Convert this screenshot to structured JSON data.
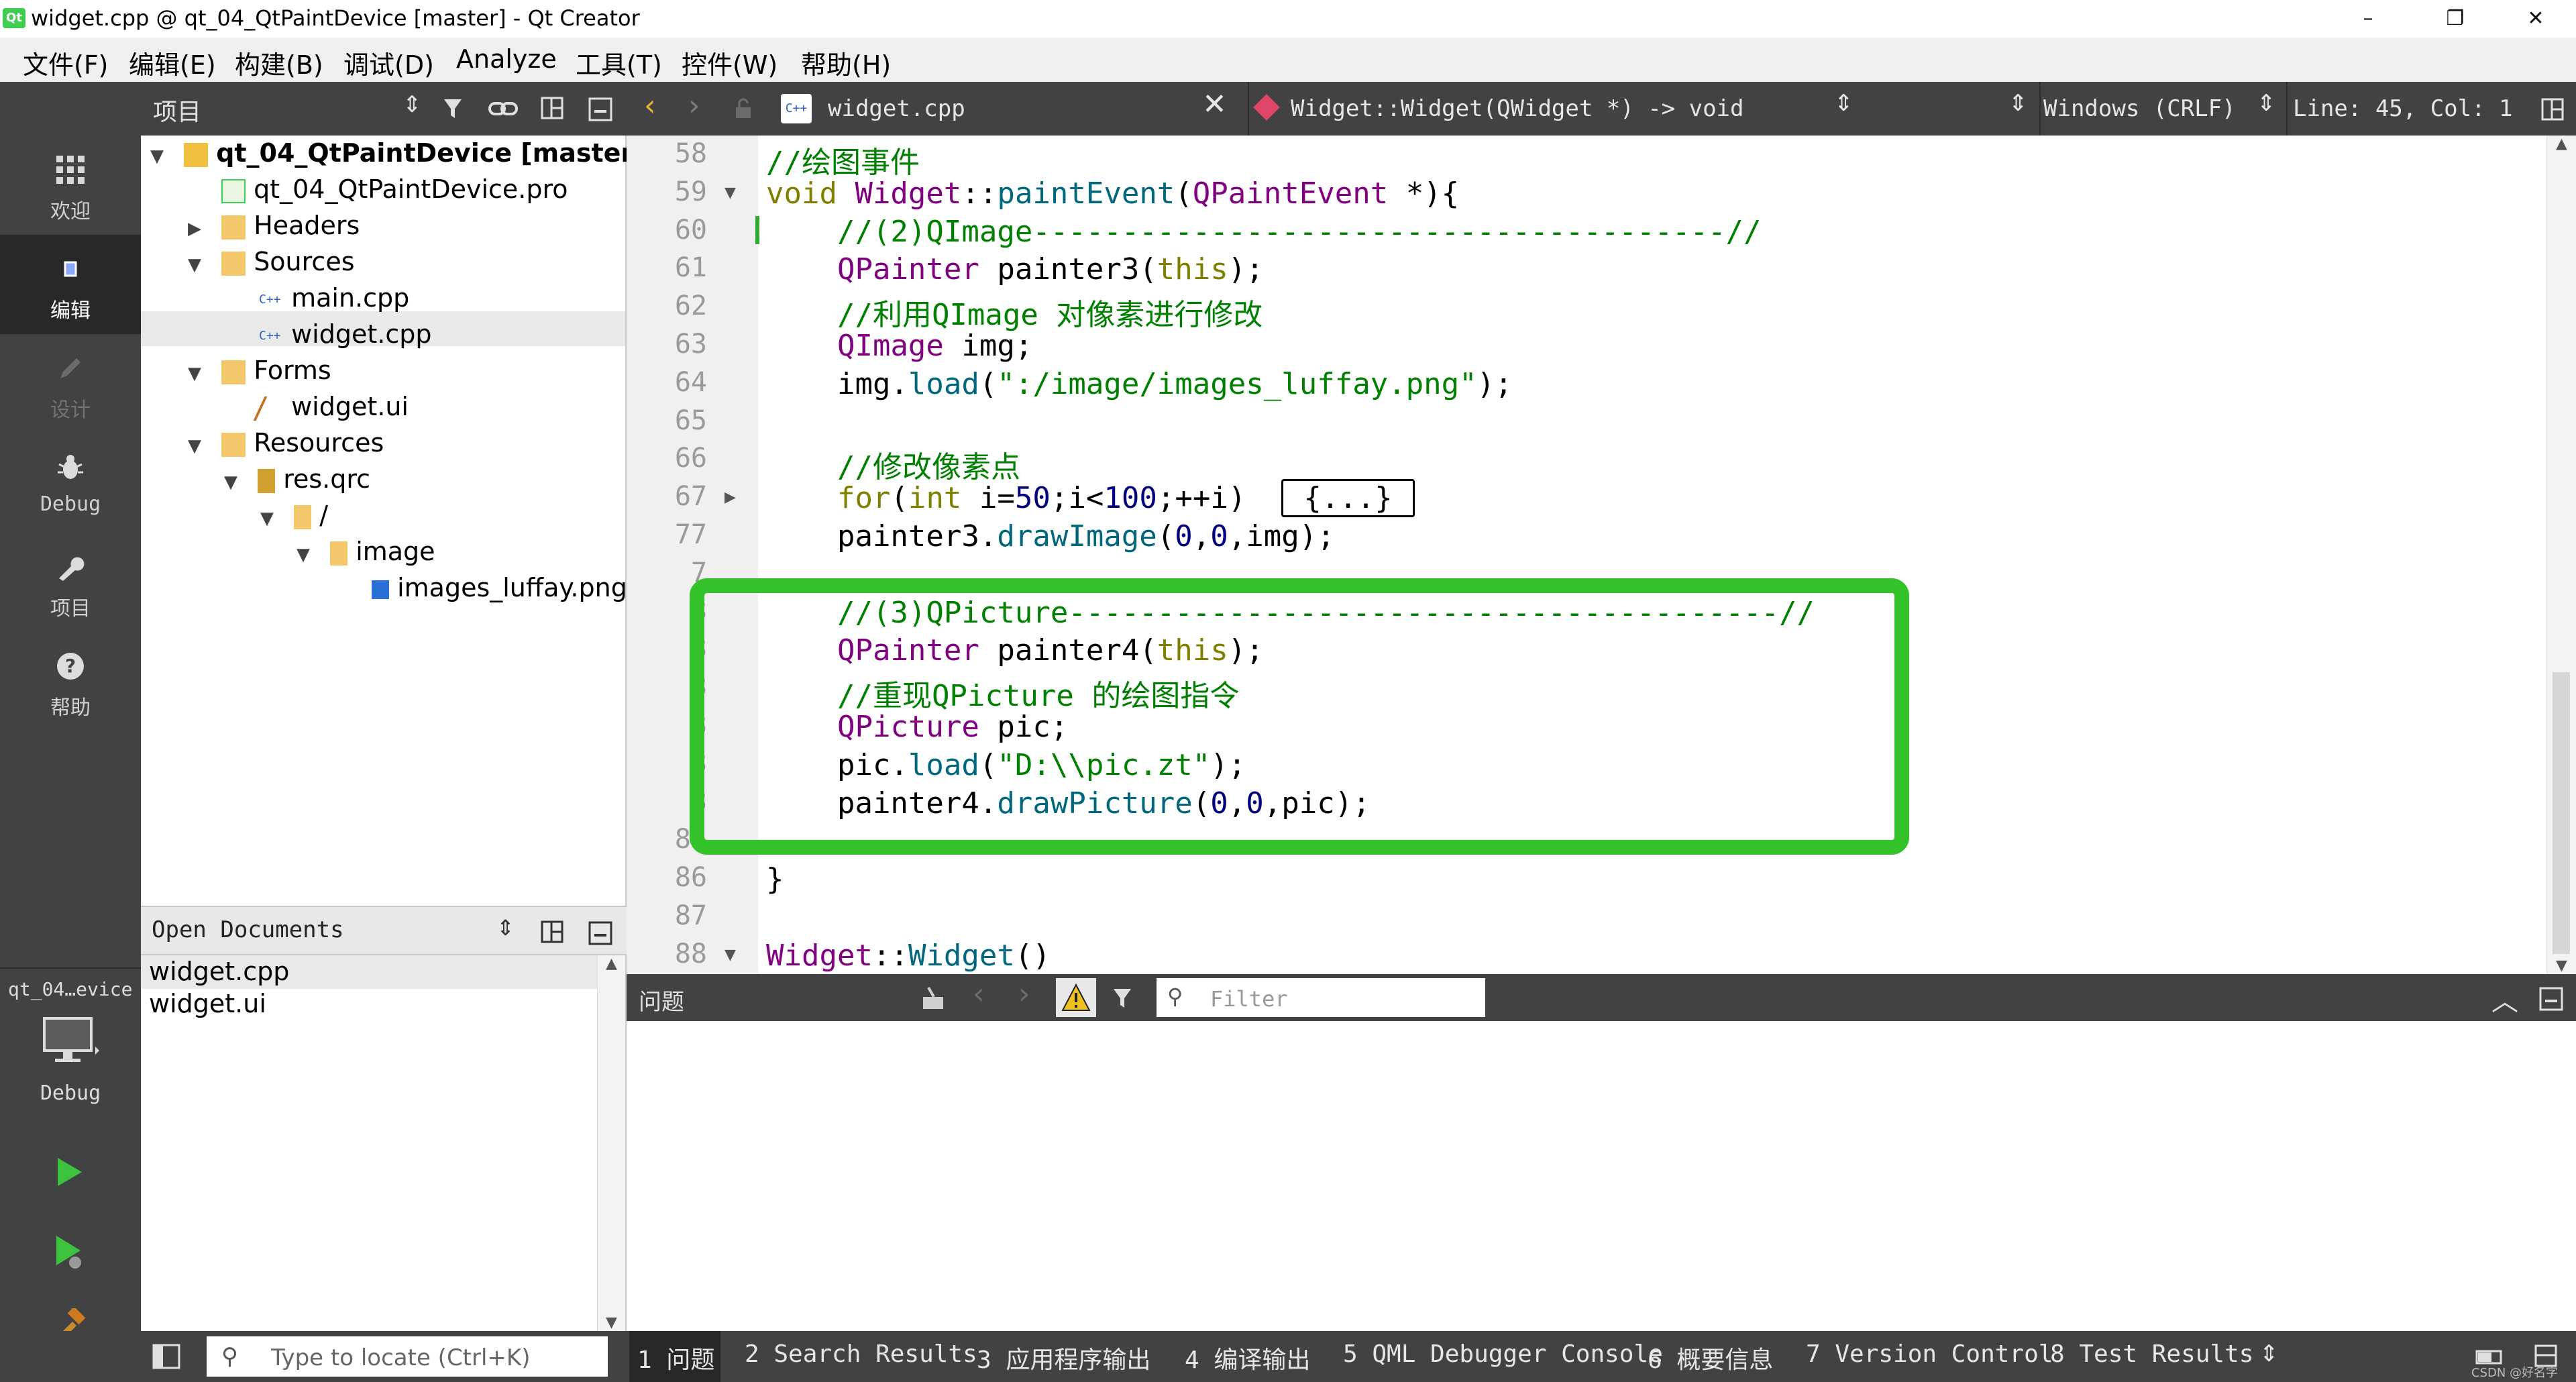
{
  "window": {
    "title": "widget.cpp @ qt_04_QtPaintDevice [master] - Qt Creator",
    "app_icon": "Qt",
    "controls": [
      "–",
      "❐",
      "✕"
    ]
  },
  "menu": [
    "文件(F)",
    "编辑(E)",
    "构建(B)",
    "调试(D)",
    "Analyze",
    "工具(T)",
    "控件(W)",
    "帮助(H)"
  ],
  "modes": [
    {
      "label": "欢迎",
      "icon": "grid-icon"
    },
    {
      "label": "编辑",
      "icon": "edit-doc-icon"
    },
    {
      "label": "设计",
      "icon": "pencil-icon"
    },
    {
      "label": "Debug",
      "icon": "bug-icon"
    },
    {
      "label": "项目",
      "icon": "wrench-icon"
    },
    {
      "label": "帮助",
      "icon": "help-icon"
    }
  ],
  "kit": {
    "name": "qt_04…evice",
    "config": "Debug"
  },
  "project_pane": {
    "title": "项目",
    "tree": [
      {
        "label": "qt_04_QtPaintDevice [master]",
        "level": 0,
        "arrow": "▼",
        "icon": "qt-project"
      },
      {
        "label": "qt_04_QtPaintDevice.pro",
        "level": 1,
        "arrow": "",
        "icon": "pro-file"
      },
      {
        "label": "Headers",
        "level": 1,
        "arrow": "▶",
        "icon": "folder-h"
      },
      {
        "label": "Sources",
        "level": 1,
        "arrow": "▼",
        "icon": "folder-cpp"
      },
      {
        "label": "main.cpp",
        "level": 2,
        "arrow": "",
        "icon": "cpp-file"
      },
      {
        "label": "widget.cpp",
        "level": 2,
        "arrow": "",
        "icon": "cpp-file"
      },
      {
        "label": "Forms",
        "level": 1,
        "arrow": "▼",
        "icon": "folder-forms"
      },
      {
        "label": "widget.ui",
        "level": 2,
        "arrow": "",
        "icon": "ui-file"
      },
      {
        "label": "Resources",
        "level": 1,
        "arrow": "▼",
        "icon": "folder-res"
      },
      {
        "label": "res.qrc",
        "level": 2,
        "arrow": "▼",
        "icon": "qrc-file"
      },
      {
        "label": "/",
        "level": 3,
        "arrow": "▼",
        "icon": "folder"
      },
      {
        "label": "image",
        "level": 4,
        "arrow": "▼",
        "icon": "folder"
      },
      {
        "label": "images_luffay.png",
        "level": 5,
        "arrow": "",
        "icon": "png-file"
      }
    ]
  },
  "open_documents": {
    "title": "Open Documents",
    "items": [
      "widget.cpp",
      "widget.ui"
    ]
  },
  "editor_toolbar": {
    "file": "widget.cpp",
    "symbol": "Widget::Widget(QWidget *) -> void",
    "line_ending": "Windows (CRLF)",
    "position": "Line: 45, Col: 1"
  },
  "code": [
    {
      "ln": "58",
      "fold": "",
      "parts": [
        {
          "t": "//绘图事件",
          "c": "cm"
        }
      ]
    },
    {
      "ln": "59",
      "fold": "▼",
      "parts": [
        {
          "t": "void ",
          "c": "kw"
        },
        {
          "t": "Widget",
          "c": "ty"
        },
        {
          "t": "::",
          "c": ""
        },
        {
          "t": "paintEvent",
          "c": "fn"
        },
        {
          "t": "(",
          "c": ""
        },
        {
          "t": "QPaintEvent",
          "c": "ty"
        },
        {
          "t": " *){",
          "c": ""
        }
      ]
    },
    {
      "ln": "60",
      "fold": "",
      "parts": [
        {
          "t": "    //(2)QImage---------------------------------------//",
          "c": "cm"
        }
      ]
    },
    {
      "ln": "61",
      "fold": "",
      "parts": [
        {
          "t": "    ",
          "c": ""
        },
        {
          "t": "QPainter",
          "c": "ty"
        },
        {
          "t": " painter3(",
          "c": ""
        },
        {
          "t": "this",
          "c": "kw"
        },
        {
          "t": ");",
          "c": ""
        }
      ]
    },
    {
      "ln": "62",
      "fold": "",
      "parts": [
        {
          "t": "    //利用QImage 对像素进行修改",
          "c": "cm"
        }
      ]
    },
    {
      "ln": "63",
      "fold": "",
      "parts": [
        {
          "t": "    ",
          "c": ""
        },
        {
          "t": "QImage",
          "c": "ty"
        },
        {
          "t": " img;",
          "c": ""
        }
      ]
    },
    {
      "ln": "64",
      "fold": "",
      "parts": [
        {
          "t": "    img.",
          "c": ""
        },
        {
          "t": "load",
          "c": "fn"
        },
        {
          "t": "(",
          "c": ""
        },
        {
          "t": "\":/image/images_luffay.png\"",
          "c": "st"
        },
        {
          "t": ");",
          "c": ""
        }
      ]
    },
    {
      "ln": "65",
      "fold": "",
      "parts": []
    },
    {
      "ln": "66",
      "fold": "",
      "parts": [
        {
          "t": "    //修改像素点",
          "c": "cm"
        }
      ]
    },
    {
      "ln": "67",
      "fold": "▶",
      "parts": [
        {
          "t": "    ",
          "c": ""
        },
        {
          "t": "for",
          "c": "kw"
        },
        {
          "t": "(",
          "c": ""
        },
        {
          "t": "int",
          "c": "kw"
        },
        {
          "t": " i=",
          "c": ""
        },
        {
          "t": "50",
          "c": "nm"
        },
        {
          "t": ";i<",
          "c": ""
        },
        {
          "t": "100",
          "c": "nm"
        },
        {
          "t": ";++i)  ",
          "c": ""
        },
        {
          "t": "{...}",
          "c": "box"
        }
      ]
    },
    {
      "ln": "77",
      "fold": "",
      "parts": [
        {
          "t": "    painter3.",
          "c": ""
        },
        {
          "t": "drawImage",
          "c": "fn"
        },
        {
          "t": "(",
          "c": ""
        },
        {
          "t": "0",
          "c": "nm"
        },
        {
          "t": ",",
          "c": ""
        },
        {
          "t": "0",
          "c": "nm"
        },
        {
          "t": ",img);",
          "c": ""
        }
      ]
    },
    {
      "ln": "7",
      "fold": "",
      "parts": []
    },
    {
      "ln": "8",
      "fold": "",
      "parts": [
        {
          "t": "    //(3)QPicture----------------------------------------//",
          "c": "cm"
        }
      ]
    },
    {
      "ln": "8",
      "fold": "",
      "parts": [
        {
          "t": "    ",
          "c": ""
        },
        {
          "t": "QPainter",
          "c": "ty"
        },
        {
          "t": " painter4(",
          "c": ""
        },
        {
          "t": "this",
          "c": "kw"
        },
        {
          "t": ");",
          "c": ""
        }
      ]
    },
    {
      "ln": "8",
      "fold": "",
      "parts": [
        {
          "t": "    //重现QPicture 的绘图指令",
          "c": "cm"
        }
      ]
    },
    {
      "ln": "8",
      "fold": "",
      "parts": [
        {
          "t": "    ",
          "c": ""
        },
        {
          "t": "QPicture",
          "c": "ty"
        },
        {
          "t": " pic;",
          "c": ""
        }
      ]
    },
    {
      "ln": "8",
      "fold": "",
      "parts": [
        {
          "t": "    pic.",
          "c": ""
        },
        {
          "t": "load",
          "c": "fn"
        },
        {
          "t": "(",
          "c": ""
        },
        {
          "t": "\"D:\\\\pic.zt\"",
          "c": "st"
        },
        {
          "t": ");",
          "c": ""
        }
      ]
    },
    {
      "ln": "8",
      "fold": "",
      "parts": [
        {
          "t": "    painter4.",
          "c": ""
        },
        {
          "t": "drawPicture",
          "c": "fn"
        },
        {
          "t": "(",
          "c": ""
        },
        {
          "t": "0",
          "c": "nm"
        },
        {
          "t": ",",
          "c": ""
        },
        {
          "t": "0",
          "c": "nm"
        },
        {
          "t": ",pic);",
          "c": ""
        }
      ]
    },
    {
      "ln": "85",
      "fold": "",
      "parts": []
    },
    {
      "ln": "86",
      "fold": "",
      "parts": [
        {
          "t": "}",
          "c": ""
        }
      ]
    },
    {
      "ln": "87",
      "fold": "",
      "parts": []
    },
    {
      "ln": "88",
      "fold": "▼",
      "parts": [
        {
          "t": "Widget",
          "c": "ty"
        },
        {
          "t": "::",
          "c": ""
        },
        {
          "t": "Widget",
          "c": "fn"
        },
        {
          "t": "()",
          "c": ""
        }
      ]
    }
  ],
  "issues_pane": {
    "title": "问题",
    "filter_placeholder": "Filter"
  },
  "locator": {
    "placeholder": "Type to locate (Ctrl+K)"
  },
  "output_tabs": [
    {
      "num": "1",
      "label": "问题"
    },
    {
      "num": "2",
      "label": "Search Results"
    },
    {
      "num": "3",
      "label": "应用程序输出"
    },
    {
      "num": "4",
      "label": "编译输出"
    },
    {
      "num": "5",
      "label": "QML Debugger Console"
    },
    {
      "num": "6",
      "label": "概要信息"
    },
    {
      "num": "7",
      "label": "Version Control"
    },
    {
      "num": "8",
      "label": "Test Results"
    }
  ],
  "watermark": "CSDN @好名字"
}
